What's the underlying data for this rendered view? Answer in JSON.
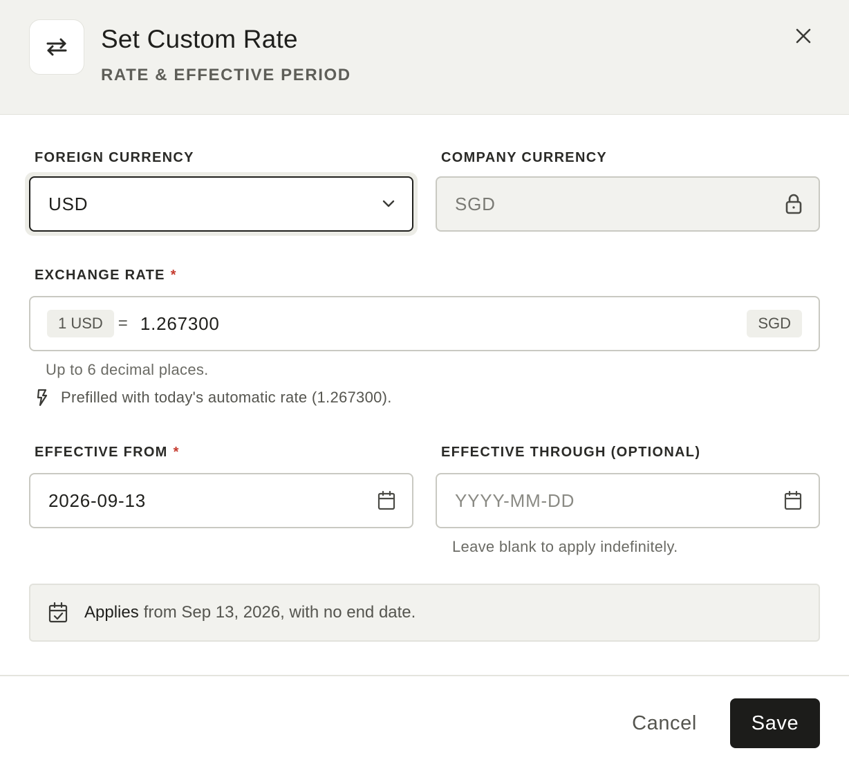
{
  "header": {
    "title": "Set Custom Rate",
    "subtitle": "RATE & EFFECTIVE PERIOD",
    "icon": "exchange-arrows-icon",
    "close_icon": "close-icon"
  },
  "foreign_currency": {
    "label": "FOREIGN CURRENCY",
    "value": "USD",
    "icon": "chevron-down-icon"
  },
  "company_currency": {
    "label": "COMPANY CURRENCY",
    "value": "SGD",
    "icon": "lock-icon"
  },
  "exchange_rate": {
    "label": "EXCHANGE RATE",
    "required_mark": "*",
    "prefix": "1 USD",
    "equals": "=",
    "value": "1.267300",
    "suffix": "SGD",
    "help": "Up to 6 decimal places.",
    "prefill_icon": "lightning-icon",
    "prefill_note": "Prefilled with today's automatic rate (1.267300)."
  },
  "effective_from": {
    "label": "EFFECTIVE FROM",
    "required_mark": "*",
    "value": "2026-09-13",
    "icon": "calendar-icon"
  },
  "effective_through": {
    "label": "EFFECTIVE THROUGH (OPTIONAL)",
    "value": "",
    "placeholder": "YYYY-MM-DD",
    "icon": "calendar-icon",
    "help": "Leave blank to apply indefinitely."
  },
  "summary": {
    "icon": "calendar-check-icon",
    "strong": "Applies",
    "text": "from Sep 13, 2026, with no end date."
  },
  "footer": {
    "cancel_label": "Cancel",
    "save_label": "Save"
  },
  "colors": {
    "header_bg": "#f2f2ee",
    "primary_button": "#1c1c1a",
    "required": "#c53a2e"
  }
}
